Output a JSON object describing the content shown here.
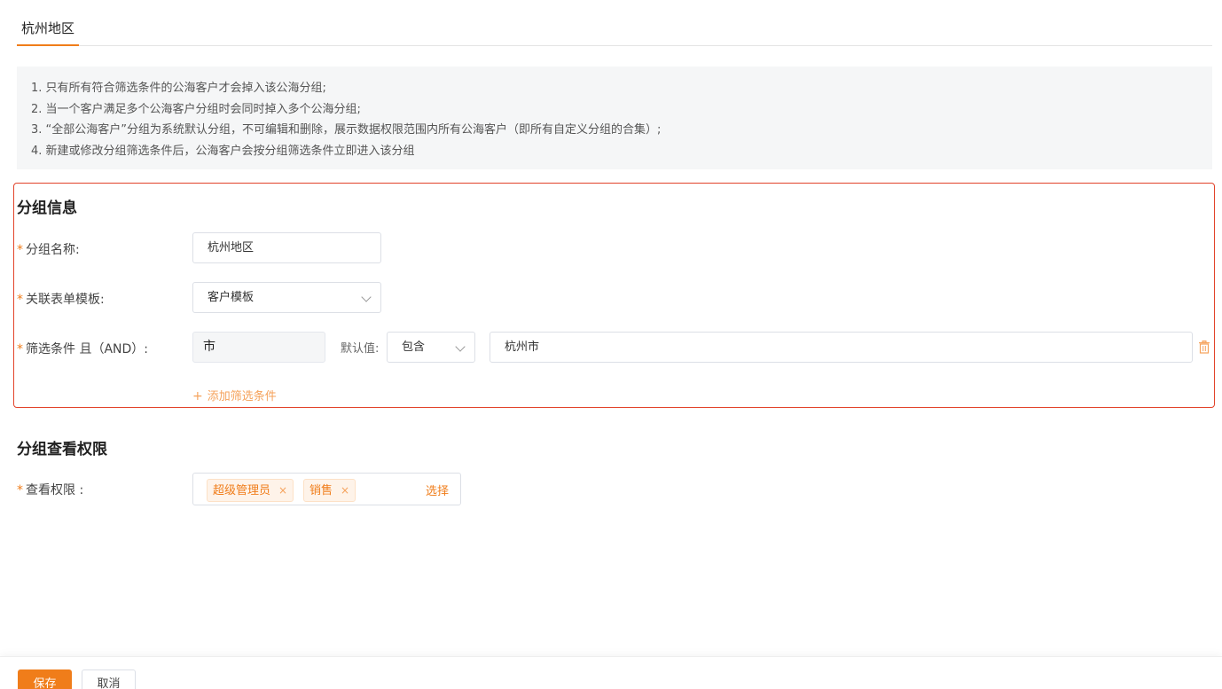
{
  "tabs": {
    "active_label": "杭州地区"
  },
  "notice": {
    "lines": [
      "1. 只有所有符合筛选条件的公海客户才会掉入该公海分组;",
      "2. 当一个客户满足多个公海客户分组时会同时掉入多个公海分组;",
      "3. “全部公海客户”分组为系统默认分组，不可编辑和删除，展示数据权限范围内所有公海客户（即所有自定义分组的合集）;",
      "4. 新建或修改分组筛选条件后，公海客户会按分组筛选条件立即进入该分组"
    ]
  },
  "group_info": {
    "title": "分组信息",
    "required_mark": "*",
    "name_label": "分组名称:",
    "name_value": "杭州地区",
    "template_label": "关联表单模板:",
    "template_value": "客户模板",
    "filter_label": "筛选条件 且（AND）:",
    "filter_field": "市",
    "default_value_label": "默认值:",
    "filter_operator": "包含",
    "filter_value": "杭州市",
    "add_condition_icon": "+",
    "add_condition_label": "添加筛选条件",
    "delete_icon": "trash-icon",
    "accent_color": "#f07d1a"
  },
  "permissions": {
    "title": "分组查看权限",
    "view_label": "查看权限 :",
    "tags": [
      "超级管理员",
      "销售"
    ],
    "tag_remove_glyph": "×",
    "select_label": "选择"
  },
  "footer": {
    "save_label": "保存",
    "cancel_label": "取消"
  }
}
